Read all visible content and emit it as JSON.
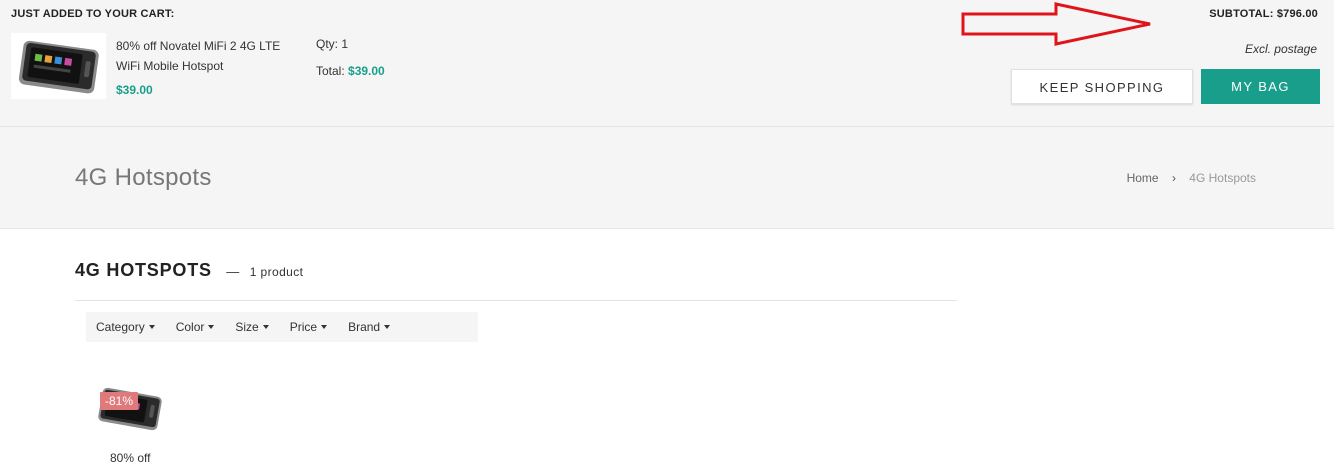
{
  "cart": {
    "heading": "JUST ADDED TO YOUR CART:",
    "item": {
      "name": "80% off Novatel MiFi 2 4G LTE WiFi Mobile Hotspot",
      "price": "$39.00",
      "qty_label": "Qty:",
      "qty_value": "1",
      "total_label": "Total:",
      "total_value": "$39.00"
    },
    "subtotal": "SUBTOTAL: $796.00",
    "postage_note": "Excl. postage",
    "keep_shopping_label": "KEEP SHOPPING",
    "my_bag_label": "MY BAG",
    "accent_color": "#1a9e8c"
  },
  "page": {
    "title": "4G Hotspots",
    "breadcrumb": {
      "home": "Home",
      "separator": "›",
      "current": "4G Hotspots"
    }
  },
  "collection": {
    "title": "4G HOTSPOTS",
    "dash": "—",
    "count": "1 product",
    "filters": [
      "Category",
      "Color",
      "Size",
      "Price",
      "Brand"
    ]
  },
  "products": [
    {
      "badge": "-81%",
      "name": "80% off"
    }
  ],
  "annotation": {
    "arrow_color": "#e0151b",
    "icon": "right-arrow-icon"
  }
}
